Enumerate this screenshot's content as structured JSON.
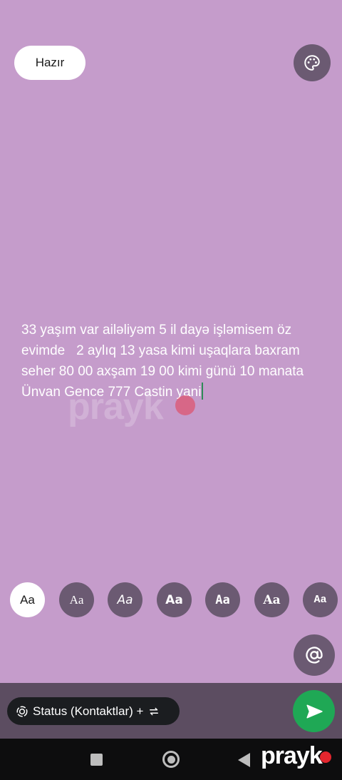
{
  "toolbar": {
    "done_label": "Hazır",
    "palette_icon": "palette-icon"
  },
  "editor": {
    "text": "33 yaşım var ailəliyəm 5 il dayə işləmisem öz evimde   2 aylıq 13 yasa kimi uşaqlara baxram seher 80 00 axşam 19 00 kimi günü 10 manata  Ünvan Gence 777 Castin yani"
  },
  "fonts": {
    "labels": [
      "Aa",
      "Aa",
      "Aa",
      "Aa",
      "Aa",
      "Aa",
      "Aa"
    ],
    "selected_index": 0
  },
  "mention": {
    "icon": "at-icon"
  },
  "audience": {
    "label": "Status (Kontaktlar) +",
    "icon": "status-icon",
    "switch_icon": "switch-icon"
  },
  "send": {
    "icon": "send-icon"
  },
  "watermark": {
    "text": "prayk"
  },
  "colors": {
    "background": "#c59ccb",
    "accent_button": "#6b5a72",
    "send": "#1fa855",
    "bottom_bar": "#5c4d61"
  }
}
